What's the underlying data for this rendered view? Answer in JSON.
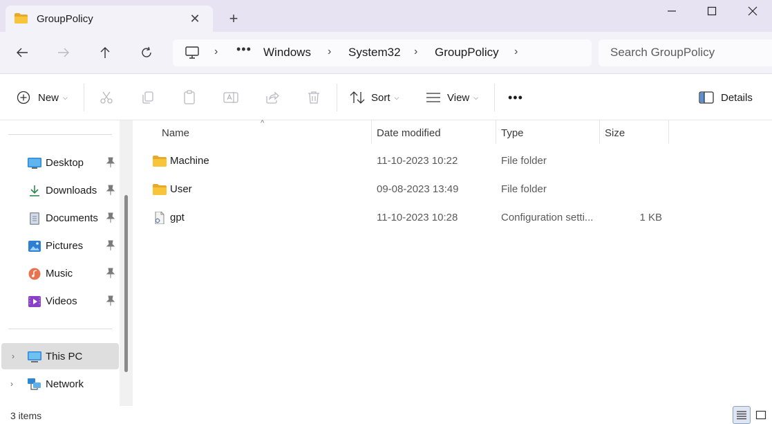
{
  "window": {
    "tab_title": "GroupPolicy",
    "close_glyph": "✕",
    "new_tab_glyph": "+"
  },
  "address_bar": {
    "overflow": "•••",
    "crumbs": [
      "Windows",
      "System32",
      "GroupPolicy"
    ],
    "icons": [
      "back-arrow-icon",
      "forward-arrow-icon",
      "up-arrow-icon",
      "refresh-icon",
      "this-pc-icon"
    ]
  },
  "search": {
    "placeholder": "Search GroupPolicy"
  },
  "toolbar": {
    "new_label": "New",
    "sort_label": "Sort",
    "view_label": "View",
    "more_label": "•••",
    "details_label": "Details",
    "chevron": "⌵",
    "icons": [
      "cut-icon",
      "copy-icon",
      "paste-icon",
      "rename-icon",
      "share-icon",
      "delete-icon"
    ]
  },
  "sidebar": {
    "pinned": [
      {
        "label": "Desktop",
        "icon": "desktop-icon"
      },
      {
        "label": "Downloads",
        "icon": "downloads-icon"
      },
      {
        "label": "Documents",
        "icon": "documents-icon"
      },
      {
        "label": "Pictures",
        "icon": "pictures-icon"
      },
      {
        "label": "Music",
        "icon": "music-icon"
      },
      {
        "label": "Videos",
        "icon": "videos-icon"
      }
    ],
    "roots": [
      {
        "label": "This PC",
        "icon": "this-pc-icon",
        "selected": true
      },
      {
        "label": "Network",
        "icon": "network-icon",
        "selected": false
      }
    ],
    "expander": "›"
  },
  "file_list": {
    "sort_caret": "^",
    "columns": [
      "Name",
      "Date modified",
      "Type",
      "Size"
    ],
    "rows": [
      {
        "name": "Machine",
        "date": "11-10-2023 10:22",
        "type": "File folder",
        "size": "",
        "icon": "folder-icon"
      },
      {
        "name": "User",
        "date": "09-08-2023 13:49",
        "type": "File folder",
        "size": "",
        "icon": "folder-icon"
      },
      {
        "name": "gpt",
        "date": "11-10-2023 10:28",
        "type": "Configuration setti...",
        "size": "1 KB",
        "icon": "config-file-icon"
      }
    ]
  },
  "status": {
    "item_count": "3 items"
  },
  "colors": {
    "title_bar": "#e8e3f3",
    "nav_bar": "#f4f2f9",
    "folder": "#f8c53a",
    "selection": "#dedede"
  }
}
